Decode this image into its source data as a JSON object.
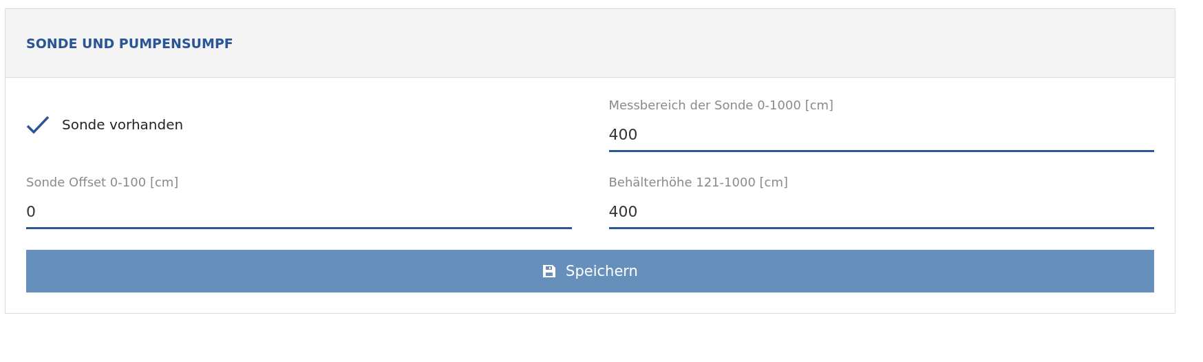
{
  "panel": {
    "title": "SONDE UND PUMPENSUMPF",
    "checkbox": {
      "label": "Sonde vorhanden",
      "checked": true
    },
    "fields": [
      {
        "label": "Messbereich der Sonde 0-1000 [cm]",
        "value": "400"
      },
      {
        "label": "Sonde Offset 0-100 [cm]",
        "value": "0"
      },
      {
        "label": "Behälterhöhe 121-1000 [cm]",
        "value": "400"
      }
    ],
    "save_button": {
      "label": "Speichern"
    }
  }
}
